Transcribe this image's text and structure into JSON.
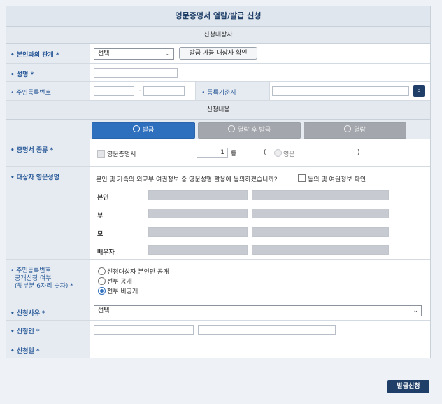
{
  "header": {
    "title": "영문증명서 열람/발급 신청"
  },
  "sections": {
    "target": "신청대상자",
    "content": "신청내용"
  },
  "relation": {
    "label": "• 본인과의 관계 *",
    "select_value": "선택",
    "check_button": "발급 가능 대상자 확인"
  },
  "name": {
    "label": "• 성명 *"
  },
  "rrn": {
    "label": "• 주민등록번호",
    "dash": "-",
    "reg_label": "• 등록기준지"
  },
  "tabs": [
    {
      "label": "발급",
      "active": true
    },
    {
      "label": "열람 후 발급",
      "active": false
    },
    {
      "label": "열람",
      "active": false
    }
  ],
  "cert_type": {
    "label": "• 증명서 종류 *",
    "checkbox_label": "영문증명서",
    "count": "1",
    "count_unit": "통",
    "paren_open": "(",
    "radio_label": "영문",
    "paren_close": ")"
  },
  "eng_name": {
    "label": "• 대상자 영문성명",
    "consent_question": "본인 및 가족의 외교부 여권정보 중 영문성명 활용에 동의하겠습니까?",
    "consent_option": "동의 및 여권정보 확인",
    "persons": [
      "본인",
      "부",
      "모",
      "배우자"
    ]
  },
  "rrn_disclosure": {
    "label_lines": [
      "• 주민등록번호",
      "공개신청 여부",
      "(뒷부분 6자리 숫자) *"
    ],
    "options": [
      {
        "label": "신청대상자 본인만 공개",
        "checked": false
      },
      {
        "label": "전부 공개",
        "checked": false
      },
      {
        "label": "전부 비공개",
        "checked": true
      }
    ]
  },
  "reason": {
    "label": "• 신청사유 *",
    "select_value": "선택"
  },
  "applicant": {
    "label": "• 신청인 *"
  },
  "date": {
    "label": "• 신청일 *"
  },
  "submit": {
    "label": "발급신청"
  },
  "colors": {
    "navy": "#1f3f68",
    "blue": "#2e6fbe",
    "label_bg": "#e6ebf1",
    "label_text": "#2a5a99"
  },
  "icons": {
    "search": "search-icon",
    "chevron": "chevron-down-icon"
  }
}
